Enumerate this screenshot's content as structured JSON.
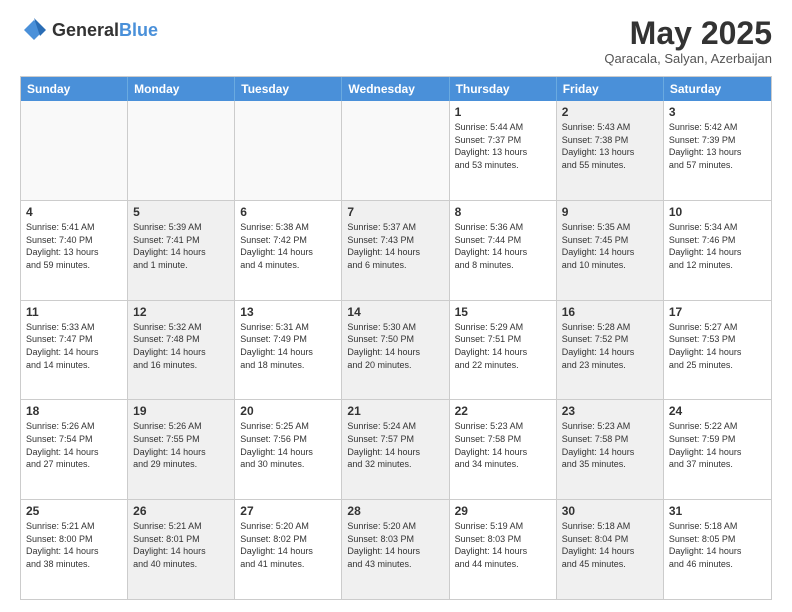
{
  "header": {
    "logo_general": "General",
    "logo_blue": "Blue",
    "title": "May 2025",
    "location": "Qaracala, Salyan, Azerbaijan"
  },
  "days_of_week": [
    "Sunday",
    "Monday",
    "Tuesday",
    "Wednesday",
    "Thursday",
    "Friday",
    "Saturday"
  ],
  "rows": [
    [
      {
        "day": "",
        "info": "",
        "empty": true
      },
      {
        "day": "",
        "info": "",
        "empty": true
      },
      {
        "day": "",
        "info": "",
        "empty": true
      },
      {
        "day": "",
        "info": "",
        "empty": true
      },
      {
        "day": "1",
        "info": "Sunrise: 5:44 AM\nSunset: 7:37 PM\nDaylight: 13 hours\nand 53 minutes."
      },
      {
        "day": "2",
        "info": "Sunrise: 5:43 AM\nSunset: 7:38 PM\nDaylight: 13 hours\nand 55 minutes.",
        "shaded": true
      },
      {
        "day": "3",
        "info": "Sunrise: 5:42 AM\nSunset: 7:39 PM\nDaylight: 13 hours\nand 57 minutes."
      }
    ],
    [
      {
        "day": "4",
        "info": "Sunrise: 5:41 AM\nSunset: 7:40 PM\nDaylight: 13 hours\nand 59 minutes."
      },
      {
        "day": "5",
        "info": "Sunrise: 5:39 AM\nSunset: 7:41 PM\nDaylight: 14 hours\nand 1 minute.",
        "shaded": true
      },
      {
        "day": "6",
        "info": "Sunrise: 5:38 AM\nSunset: 7:42 PM\nDaylight: 14 hours\nand 4 minutes."
      },
      {
        "day": "7",
        "info": "Sunrise: 5:37 AM\nSunset: 7:43 PM\nDaylight: 14 hours\nand 6 minutes.",
        "shaded": true
      },
      {
        "day": "8",
        "info": "Sunrise: 5:36 AM\nSunset: 7:44 PM\nDaylight: 14 hours\nand 8 minutes."
      },
      {
        "day": "9",
        "info": "Sunrise: 5:35 AM\nSunset: 7:45 PM\nDaylight: 14 hours\nand 10 minutes.",
        "shaded": true
      },
      {
        "day": "10",
        "info": "Sunrise: 5:34 AM\nSunset: 7:46 PM\nDaylight: 14 hours\nand 12 minutes."
      }
    ],
    [
      {
        "day": "11",
        "info": "Sunrise: 5:33 AM\nSunset: 7:47 PM\nDaylight: 14 hours\nand 14 minutes."
      },
      {
        "day": "12",
        "info": "Sunrise: 5:32 AM\nSunset: 7:48 PM\nDaylight: 14 hours\nand 16 minutes.",
        "shaded": true
      },
      {
        "day": "13",
        "info": "Sunrise: 5:31 AM\nSunset: 7:49 PM\nDaylight: 14 hours\nand 18 minutes."
      },
      {
        "day": "14",
        "info": "Sunrise: 5:30 AM\nSunset: 7:50 PM\nDaylight: 14 hours\nand 20 minutes.",
        "shaded": true
      },
      {
        "day": "15",
        "info": "Sunrise: 5:29 AM\nSunset: 7:51 PM\nDaylight: 14 hours\nand 22 minutes."
      },
      {
        "day": "16",
        "info": "Sunrise: 5:28 AM\nSunset: 7:52 PM\nDaylight: 14 hours\nand 23 minutes.",
        "shaded": true
      },
      {
        "day": "17",
        "info": "Sunrise: 5:27 AM\nSunset: 7:53 PM\nDaylight: 14 hours\nand 25 minutes."
      }
    ],
    [
      {
        "day": "18",
        "info": "Sunrise: 5:26 AM\nSunset: 7:54 PM\nDaylight: 14 hours\nand 27 minutes."
      },
      {
        "day": "19",
        "info": "Sunrise: 5:26 AM\nSunset: 7:55 PM\nDaylight: 14 hours\nand 29 minutes.",
        "shaded": true
      },
      {
        "day": "20",
        "info": "Sunrise: 5:25 AM\nSunset: 7:56 PM\nDaylight: 14 hours\nand 30 minutes."
      },
      {
        "day": "21",
        "info": "Sunrise: 5:24 AM\nSunset: 7:57 PM\nDaylight: 14 hours\nand 32 minutes.",
        "shaded": true
      },
      {
        "day": "22",
        "info": "Sunrise: 5:23 AM\nSunset: 7:58 PM\nDaylight: 14 hours\nand 34 minutes."
      },
      {
        "day": "23",
        "info": "Sunrise: 5:23 AM\nSunset: 7:58 PM\nDaylight: 14 hours\nand 35 minutes.",
        "shaded": true
      },
      {
        "day": "24",
        "info": "Sunrise: 5:22 AM\nSunset: 7:59 PM\nDaylight: 14 hours\nand 37 minutes."
      }
    ],
    [
      {
        "day": "25",
        "info": "Sunrise: 5:21 AM\nSunset: 8:00 PM\nDaylight: 14 hours\nand 38 minutes."
      },
      {
        "day": "26",
        "info": "Sunrise: 5:21 AM\nSunset: 8:01 PM\nDaylight: 14 hours\nand 40 minutes.",
        "shaded": true
      },
      {
        "day": "27",
        "info": "Sunrise: 5:20 AM\nSunset: 8:02 PM\nDaylight: 14 hours\nand 41 minutes."
      },
      {
        "day": "28",
        "info": "Sunrise: 5:20 AM\nSunset: 8:03 PM\nDaylight: 14 hours\nand 43 minutes.",
        "shaded": true
      },
      {
        "day": "29",
        "info": "Sunrise: 5:19 AM\nSunset: 8:03 PM\nDaylight: 14 hours\nand 44 minutes."
      },
      {
        "day": "30",
        "info": "Sunrise: 5:18 AM\nSunset: 8:04 PM\nDaylight: 14 hours\nand 45 minutes.",
        "shaded": true
      },
      {
        "day": "31",
        "info": "Sunrise: 5:18 AM\nSunset: 8:05 PM\nDaylight: 14 hours\nand 46 minutes."
      }
    ]
  ]
}
